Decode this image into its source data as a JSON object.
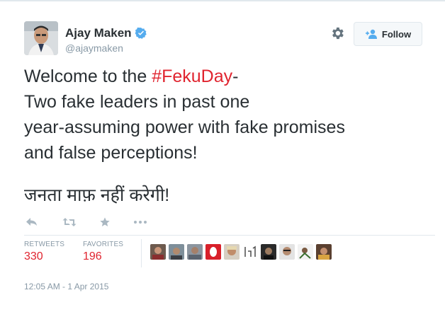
{
  "user": {
    "name": "Ajay Maken",
    "handle": "@ajaymaken"
  },
  "follow_button": {
    "label": "Follow"
  },
  "tweet": {
    "line1_prefix": "Welcome to the ",
    "hashtag": "#FekuDay",
    "line1_suffix": "-",
    "line2": "Two fake leaders in past one",
    "line3": "year-assuming power with fake promises",
    "line4": "and false perceptions!",
    "hindi": "जनता माफ़ नहीं करेगी!"
  },
  "stats": {
    "retweets_label": "RETWEETS",
    "retweets_value": "330",
    "favorites_label": "FAVORITES",
    "favorites_value": "196"
  },
  "timestamp": "12:05 AM - 1 Apr 2015",
  "icons": {
    "reply": "reply-icon",
    "retweet": "retweet-icon",
    "favorite": "star-icon",
    "more": "more-icon",
    "settings": "gear-icon",
    "verified": "verified-badge-icon",
    "follow": "add-user-icon"
  },
  "colors": {
    "hashtag": "#e0242f",
    "stat_value": "#e0242f",
    "verified": "#55acee",
    "muted": "#8899a6",
    "action_icon": "#aab8c2"
  }
}
